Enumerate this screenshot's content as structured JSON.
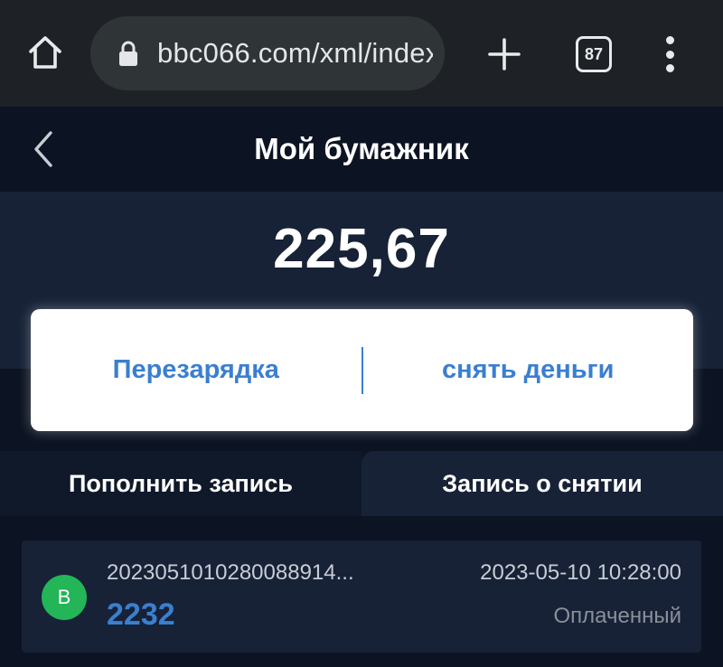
{
  "browser": {
    "url": "bbc066.com/xml/index",
    "tab_count": "87"
  },
  "header": {
    "title": "Мой бумажник"
  },
  "wallet": {
    "balance": "225,67",
    "recharge_label": "Перезарядка",
    "withdraw_label": "снять деньги"
  },
  "tabs": [
    {
      "label": "Пополнить запись"
    },
    {
      "label": "Запись о снятии"
    }
  ],
  "records": [
    {
      "badge": "B",
      "id": "2023051010280088914...",
      "time": "2023-05-10 10:28:00",
      "amount": "2232",
      "status": "Оплаченный"
    }
  ],
  "colors": {
    "accent_blue": "#3a7fd0",
    "badge_green": "#23b557",
    "page_bg": "#0c1322",
    "panel_bg": "#172237"
  }
}
